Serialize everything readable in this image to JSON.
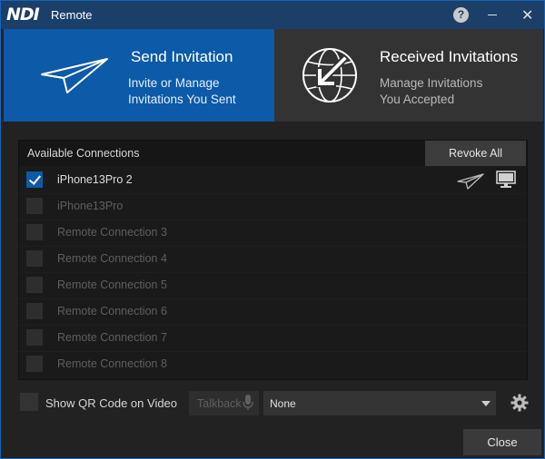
{
  "window": {
    "logo": "NDI",
    "title": "Remote",
    "help_icon": "help-icon",
    "minimize_icon": "minimize-icon",
    "close_icon": "close-icon"
  },
  "tabs": [
    {
      "title": "Send Invitation",
      "subtitle_line1": "Invite or Manage",
      "subtitle_line2": "Invitations You Sent",
      "icon": "paper-plane-icon",
      "active": true
    },
    {
      "title": "Received Invitations",
      "subtitle_line1": "Manage Invitations",
      "subtitle_line2": "You Accepted",
      "icon": "globe-arrow-icon",
      "active": false
    }
  ],
  "connections": {
    "header": "Available Connections",
    "revoke_label": "Revoke All",
    "rows": [
      {
        "label": "iPhone13Pro 2",
        "checked": true,
        "enabled": true
      },
      {
        "label": "iPhone13Pro",
        "checked": false,
        "enabled": false
      },
      {
        "label": "Remote Connection 3",
        "checked": false,
        "enabled": false
      },
      {
        "label": "Remote Connection 4",
        "checked": false,
        "enabled": false
      },
      {
        "label": "Remote Connection 5",
        "checked": false,
        "enabled": false
      },
      {
        "label": "Remote Connection 6",
        "checked": false,
        "enabled": false
      },
      {
        "label": "Remote Connection 7",
        "checked": false,
        "enabled": false
      },
      {
        "label": "Remote Connection 8",
        "checked": false,
        "enabled": false
      }
    ],
    "row_icons": [
      "paper-plane-icon",
      "monitor-icon"
    ]
  },
  "bottom": {
    "qr_label": "Show QR Code on Video",
    "talkback_label": "Talkback",
    "select_value": "None",
    "gear_icon": "gear-icon",
    "close_label": "Close"
  },
  "colors": {
    "accent": "#0c5aa8",
    "titlebar": "#1b3f68",
    "background": "#222222"
  }
}
